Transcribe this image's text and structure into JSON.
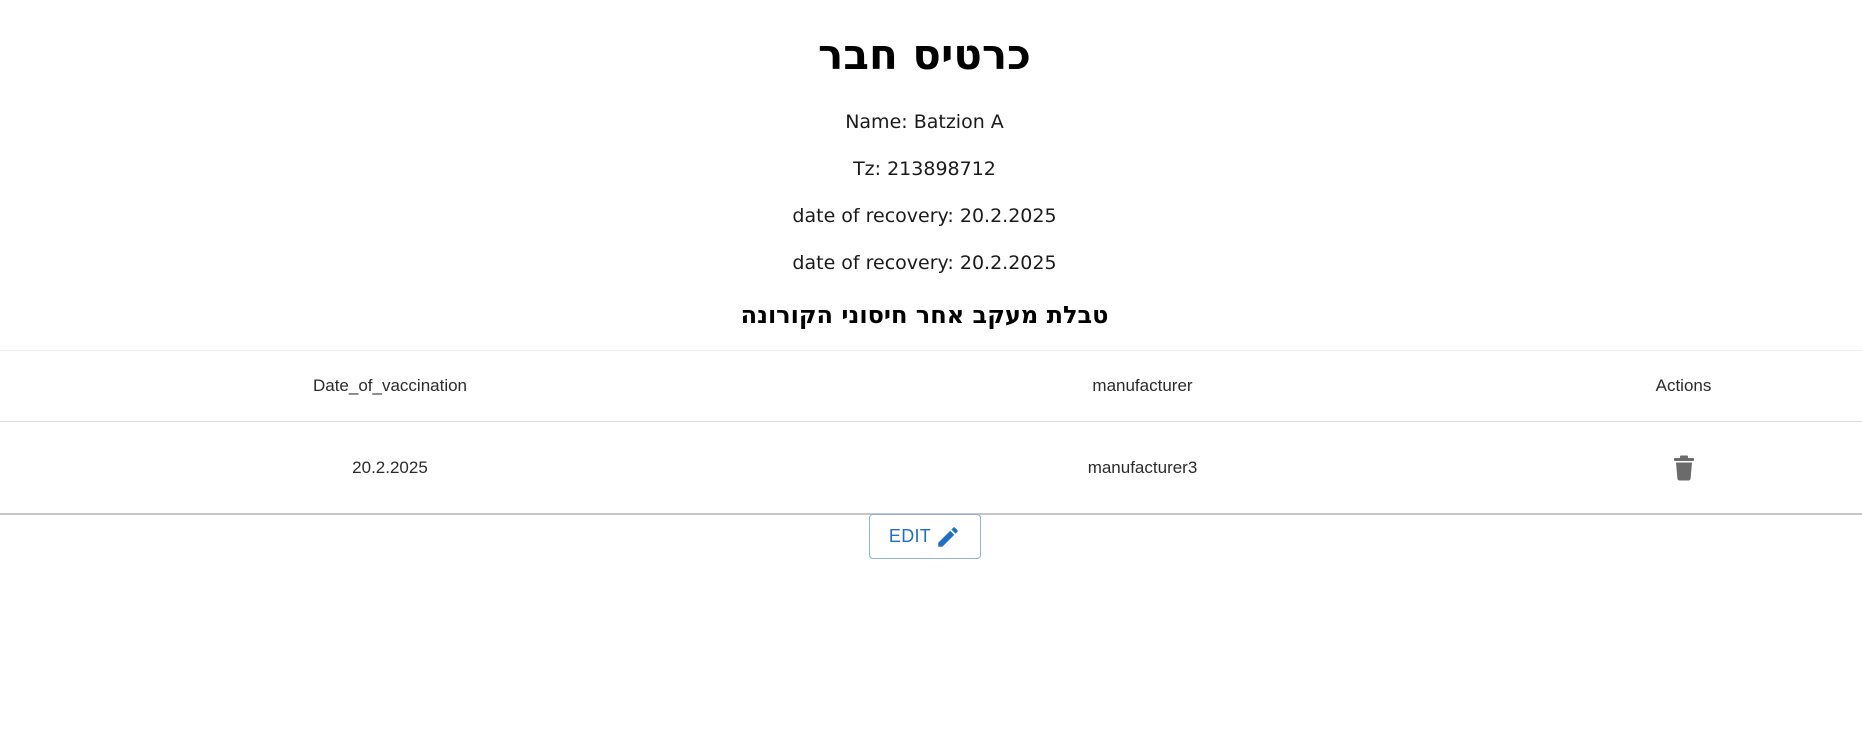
{
  "card": {
    "title": "כרטיס חבר",
    "name_line": "Name: Batzion A",
    "tz_line": "Tz: 213898712",
    "recovery_line_1": "date of recovery: 20.2.2025",
    "recovery_line_2": "date of recovery: 20.2.2025"
  },
  "vaccinations": {
    "table_title": "טבלת מעקב אחר חיסוני הקורונה",
    "columns": [
      "Date_of_vaccination",
      "manufacturer",
      "Actions"
    ],
    "rows": [
      {
        "date": "20.2.2025",
        "manufacturer": "manufacturer3",
        "action_icon": "trash-icon"
      }
    ]
  },
  "actions": {
    "edit_label": "EDIT",
    "edit_icon": "pencil-icon"
  },
  "colors": {
    "accent": "#1e6fc7",
    "icon_gray": "#6b6b6b",
    "text": "#212121"
  }
}
